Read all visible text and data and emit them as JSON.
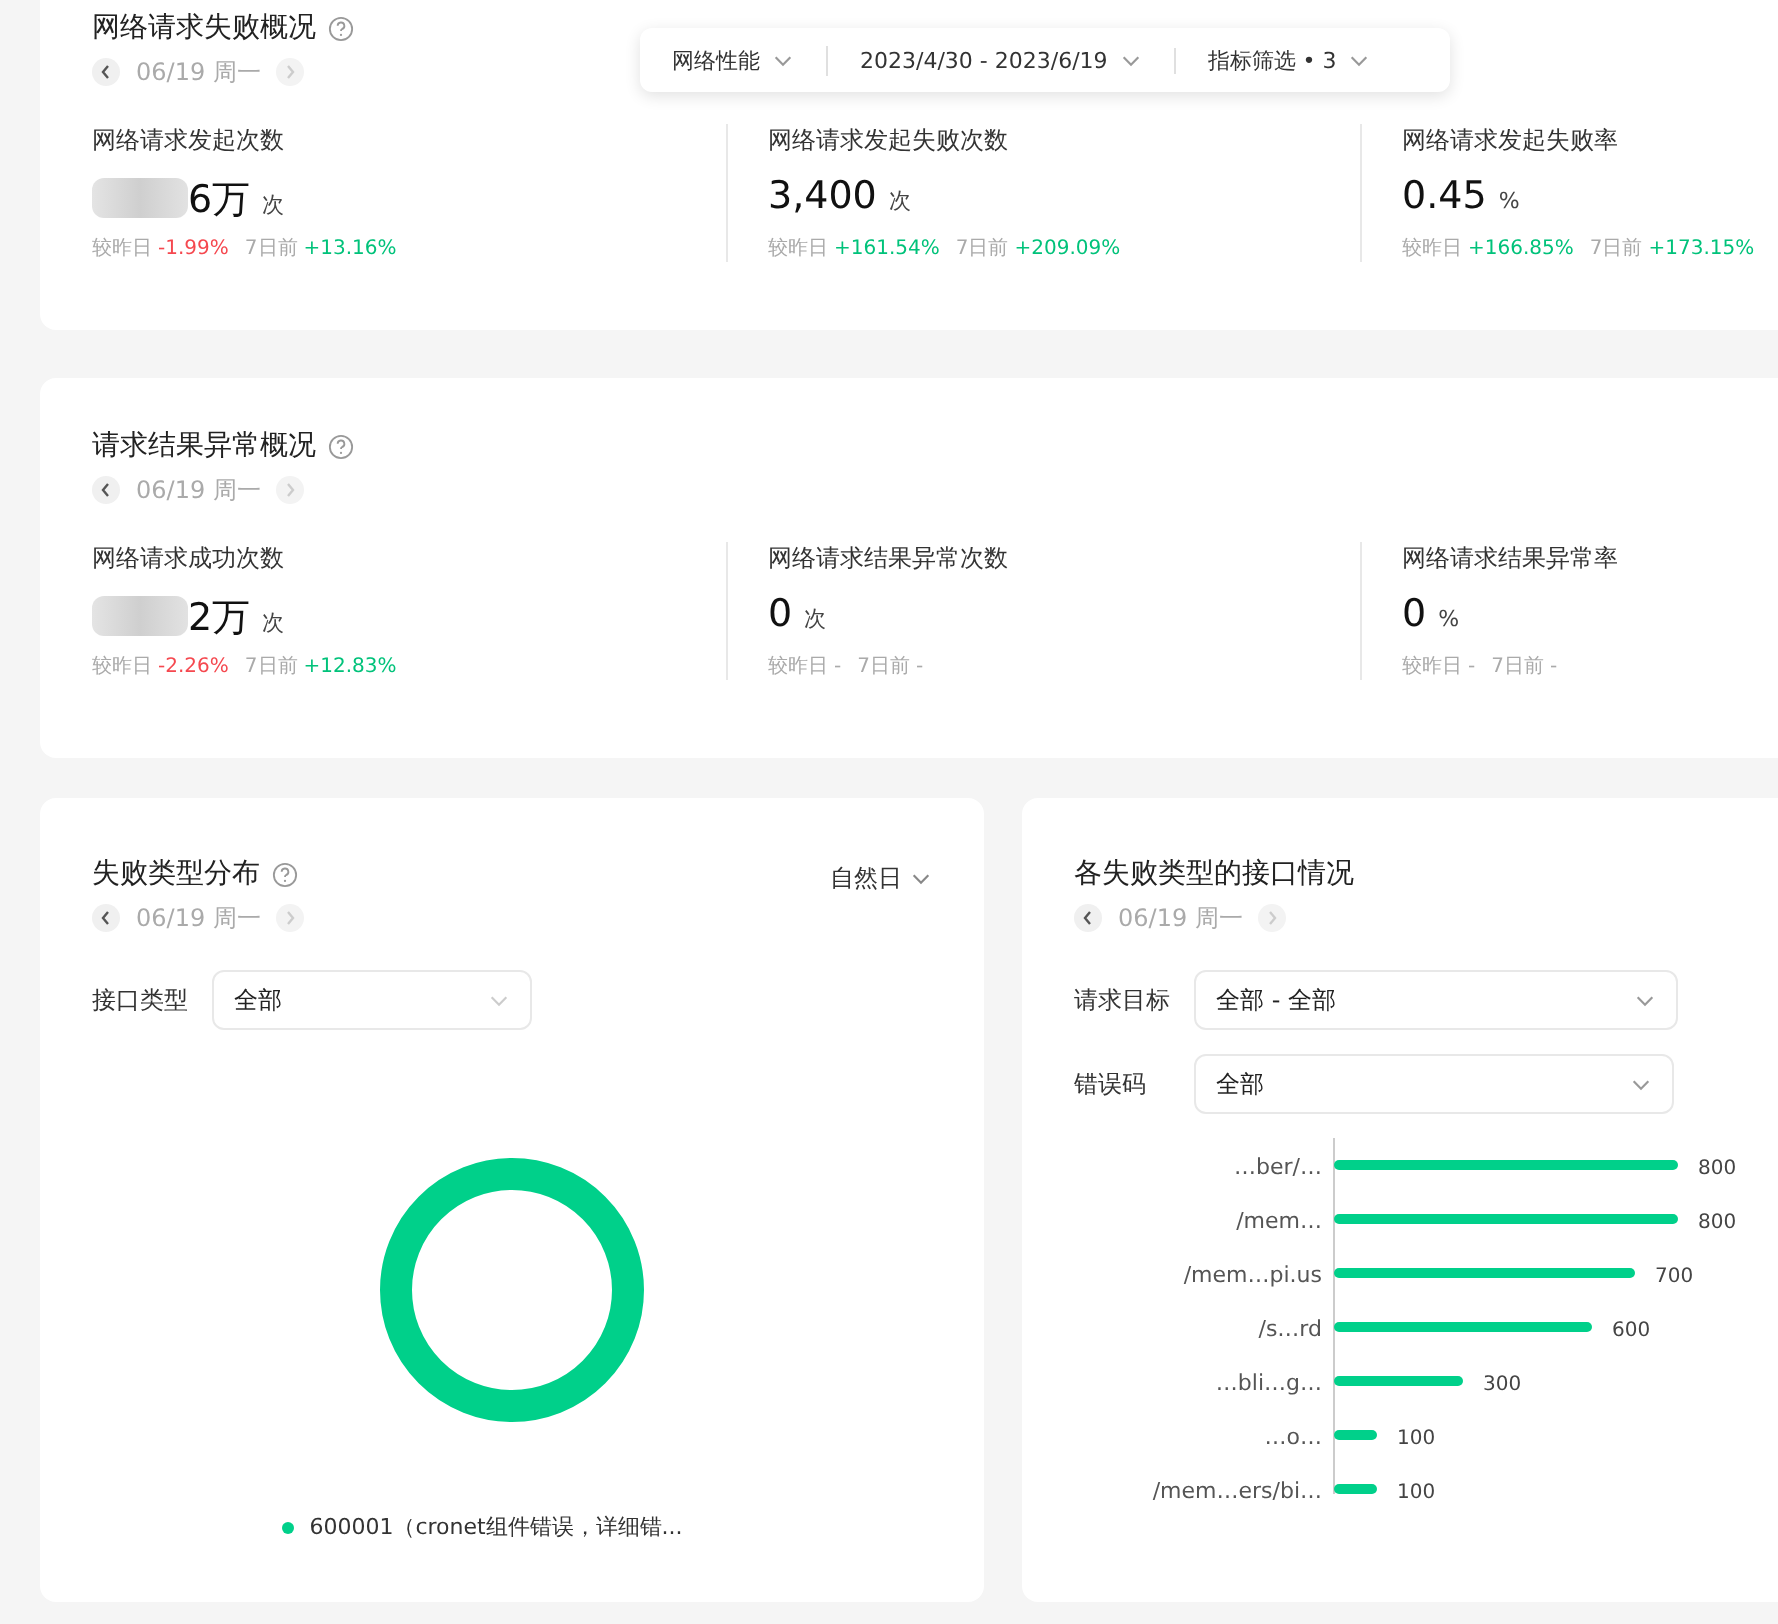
{
  "toolbar": [
    {
      "label": "网络性能"
    },
    {
      "label": "2023/4/30 - 2023/6/19"
    },
    {
      "label": "指标筛选 • 3"
    }
  ],
  "overview_cards": [
    {
      "title": "网络请求失败概况",
      "date": "06/19 周一",
      "metrics": [
        {
          "label": "网络请求发起次数",
          "value": "6万",
          "unit": "次",
          "redacted": true,
          "compare": [
            {
              "label": "较昨日",
              "change": "-1.99%",
              "color": "#f5484f"
            },
            {
              "label": "7日前",
              "change": "+13.16%",
              "color": "#00c27a"
            }
          ]
        },
        {
          "label": "网络请求发起失败次数",
          "value": "3,400",
          "unit": "次",
          "redacted": false,
          "compare": [
            {
              "label": "较昨日",
              "change": "+161.54%",
              "color": "#00c27a"
            },
            {
              "label": "7日前",
              "change": "+209.09%",
              "color": "#00c27a"
            }
          ]
        },
        {
          "label": "网络请求发起失败率",
          "value": "0.45",
          "unit": "%",
          "redacted": false,
          "compare": [
            {
              "label": "较昨日",
              "change": "+166.85%",
              "color": "#00c27a"
            },
            {
              "label": "7日前",
              "change": "+173.15%",
              "color": "#00c27a"
            }
          ]
        }
      ]
    },
    {
      "title": "请求结果异常概况",
      "date": "06/19 周一",
      "metrics": [
        {
          "label": "网络请求成功次数",
          "value": "2万",
          "unit": "次",
          "redacted": true,
          "compare": [
            {
              "label": "较昨日",
              "change": "-2.26%",
              "color": "#f5484f"
            },
            {
              "label": "7日前",
              "change": "+12.83%",
              "color": "#00c27a"
            }
          ]
        },
        {
          "label": "网络请求结果异常次数",
          "value": "0",
          "unit": "次",
          "redacted": false,
          "compare": [
            {
              "label": "较昨日",
              "change": "-",
              "color": "#aaaaaa"
            },
            {
              "label": "7日前",
              "change": "-",
              "color": "#aaaaaa"
            }
          ]
        },
        {
          "label": "网络请求结果异常率",
          "value": "0",
          "unit": "%",
          "redacted": false,
          "compare": [
            {
              "label": "较昨日",
              "change": "-",
              "color": "#aaaaaa"
            },
            {
              "label": "7日前",
              "change": "-",
              "color": "#aaaaaa"
            }
          ]
        }
      ]
    }
  ],
  "failure_types": {
    "title": "失败类型分布",
    "date": "06/19 周一",
    "period": "自然日",
    "filters": [
      {
        "label": "接口类型",
        "value": "全部"
      }
    ],
    "legend": [
      {
        "label": "600001（cronet组件错误，详细错...",
        "color": "#00d08a"
      }
    ]
  },
  "endpoints": {
    "title": "各失败类型的接口情况",
    "date": "06/19 周一",
    "filters": [
      {
        "label": "请求目标",
        "value": "全部 - 全部"
      },
      {
        "label": "错误码",
        "value": "全部"
      }
    ],
    "chart_data": {
      "type": "bar",
      "orientation": "horizontal",
      "data_labels": true,
      "categories": [
        "…ber/…",
        "/mem…",
        "/mem…pi.us",
        "/s…rd",
        "…bli…g…",
        "…o…",
        "/mem…ers/bi…"
      ],
      "series": [
        {
          "color": "#00d08a",
          "values": [
            800,
            800,
            700,
            600,
            300,
            100,
            100
          ]
        }
      ]
    }
  }
}
